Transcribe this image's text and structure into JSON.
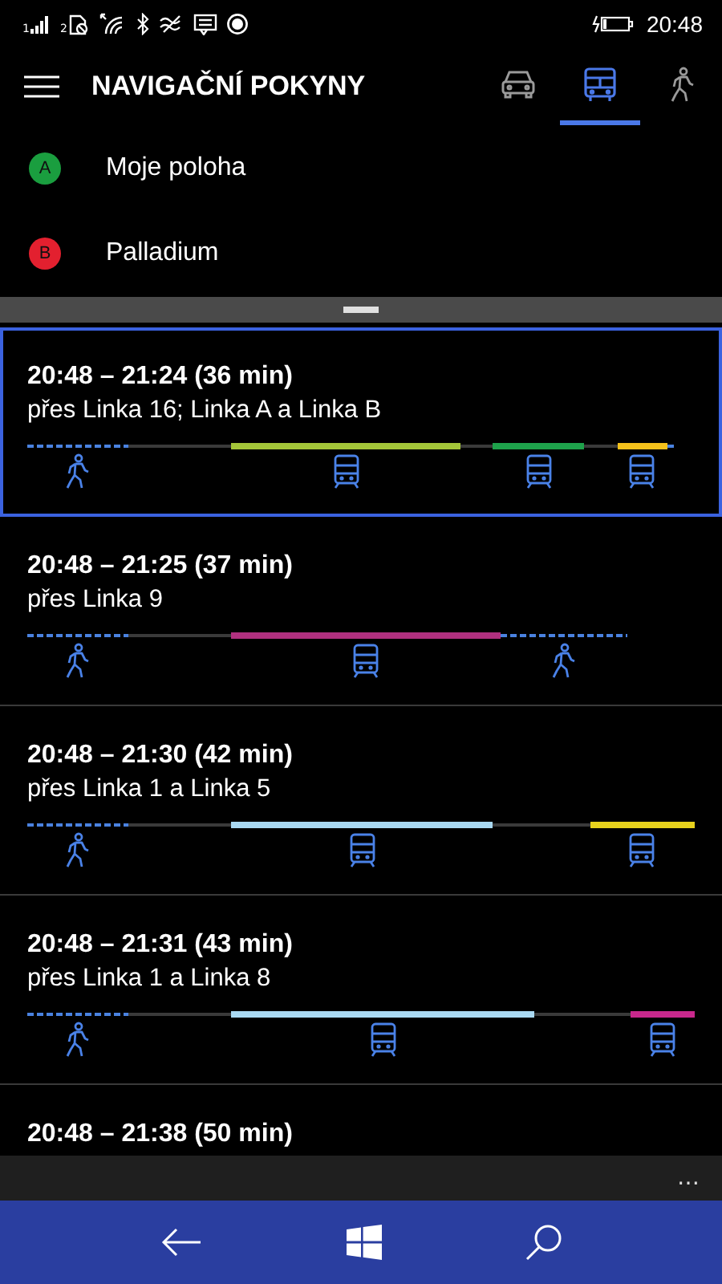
{
  "status_bar": {
    "sim_1": "1",
    "sim_2": "2",
    "time": "20:48"
  },
  "header": {
    "title": "NAVIGAČNÍ POKYNY",
    "modes": [
      {
        "kind": "car",
        "selected": false
      },
      {
        "kind": "bus",
        "selected": true
      },
      {
        "kind": "walk",
        "selected": false
      }
    ]
  },
  "locations": [
    {
      "marker": "A",
      "color": "#1a9e3f",
      "label": "Moje poloha"
    },
    {
      "marker": "B",
      "color": "#e3202f",
      "label": "Palladium"
    }
  ],
  "routes": [
    {
      "time": "20:48 – 21:24 (36 min)",
      "via": "přes Linka 16; Linka A a Linka B",
      "selected": true,
      "segments": [
        {
          "kind": "walk"
        },
        {
          "kind": "wait"
        },
        {
          "kind": "transit",
          "color": "#a4c639"
        },
        {
          "kind": "wait"
        },
        {
          "kind": "transit",
          "color": "#1ea24b"
        },
        {
          "kind": "wait"
        },
        {
          "kind": "transit",
          "color": "#f5c21b"
        },
        {
          "kind": "walk"
        }
      ]
    },
    {
      "time": "20:48 – 21:25 (37 min)",
      "via": "přes Linka 9",
      "selected": false,
      "segments": [
        {
          "kind": "walk"
        },
        {
          "kind": "wait"
        },
        {
          "kind": "transit",
          "color": "#b0307f"
        },
        {
          "kind": "walk"
        }
      ]
    },
    {
      "time": "20:48 – 21:30 (42 min)",
      "via": "přes Linka 1 a Linka 5",
      "selected": false,
      "segments": [
        {
          "kind": "walk"
        },
        {
          "kind": "wait"
        },
        {
          "kind": "transit",
          "color": "#a9d9f2"
        },
        {
          "kind": "wait"
        },
        {
          "kind": "transit",
          "color": "#e8d21d"
        }
      ]
    },
    {
      "time": "20:48 – 21:31 (43 min)",
      "via": "přes Linka 1 a Linka 8",
      "selected": false,
      "segments": [
        {
          "kind": "walk"
        },
        {
          "kind": "wait"
        },
        {
          "kind": "transit",
          "color": "#a9d9f2"
        },
        {
          "kind": "wait"
        },
        {
          "kind": "transit",
          "color": "#c8288c"
        }
      ]
    },
    {
      "time": "20:48 – 21:38 (50 min)",
      "selected": false
    }
  ],
  "app_bar": {
    "more": "…"
  }
}
